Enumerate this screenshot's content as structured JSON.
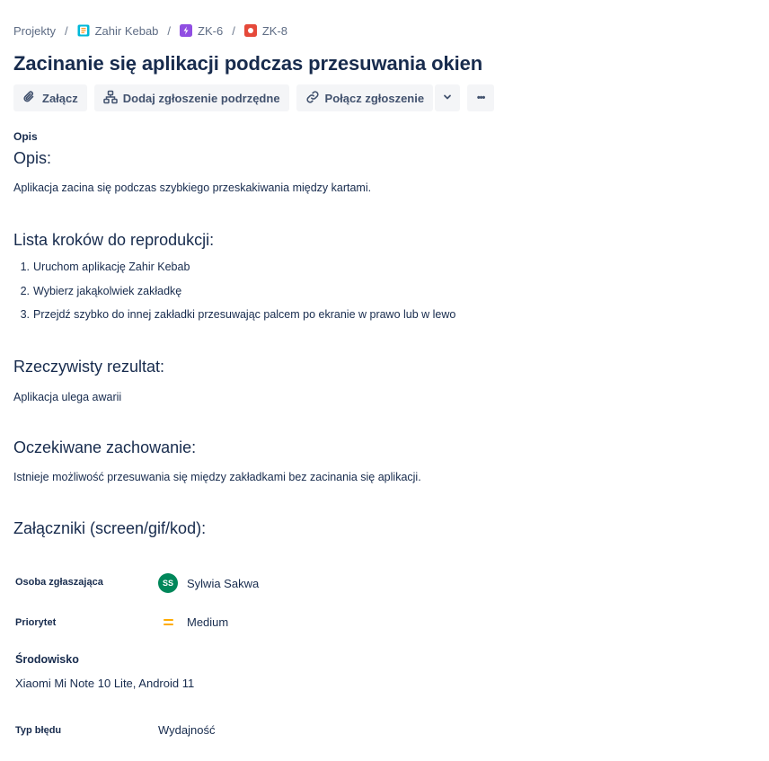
{
  "breadcrumb": {
    "projects": "Projekty",
    "project": "Zahir Kebab",
    "epic": "ZK-6",
    "issue": "ZK-8",
    "separator": "/",
    "icons": [
      "project-icon",
      "epic-icon",
      "bug-icon"
    ]
  },
  "issue": {
    "title": "Zacinanie się aplikacji podczas przesuwania okien"
  },
  "toolbar": {
    "attach_label": "Załącz",
    "add_child_label": "Dodaj zgłoszenie podrzędne",
    "link_issue_label": "Połącz zgłoszenie",
    "more_label": "•••"
  },
  "description": {
    "field_label": "Opis",
    "heading_desc": "Opis:",
    "desc_text": "Aplikacja zacina się podczas szybkiego przeskakiwania między kartami.",
    "heading_steps": "Lista kroków do reprodukcji:",
    "steps": [
      {
        "num": "1.",
        "text": "Uruchom aplikację Zahir Kebab"
      },
      {
        "num": "2.",
        "text": "Wybierz jakąkolwiek zakładkę"
      },
      {
        "num": "3.",
        "text": "Przejdź szybko do innej zakładki przesuwając palcem po ekranie w prawo lub w lewo"
      }
    ],
    "heading_actual": "Rzeczywisty rezultat:",
    "actual_text": "Aplikacja ulega awarii",
    "heading_expected": "Oczekiwane zachowanie:",
    "expected_text": "Istnieje możliwość przesuwania się między zakładkami bez zacinania się aplikacji.",
    "heading_attachments": "Załączniki (screen/gif/kod):"
  },
  "fields": {
    "reporter_label": "Osoba zgłaszająca",
    "reporter_initials": "SS",
    "reporter_name": "Sylwia Sakwa",
    "priority_label": "Priorytet",
    "priority_value": "Medium",
    "environment_label": "Środowisko",
    "environment_value": "Xiaomi Mi Note 10 Lite, Android 11",
    "bug_type_label": "Typ błędu",
    "bug_type_value": "Wydajność"
  },
  "colors": {
    "text_primary": "#172b4d",
    "text_secondary": "#5e6c84",
    "button_bg": "#f4f5f7",
    "avatar_bg": "#00875a",
    "priority_medium": "#ffab00",
    "epic_purple": "#904ee2",
    "bug_red": "#e5493a",
    "project_teal": "#00b8d9"
  }
}
